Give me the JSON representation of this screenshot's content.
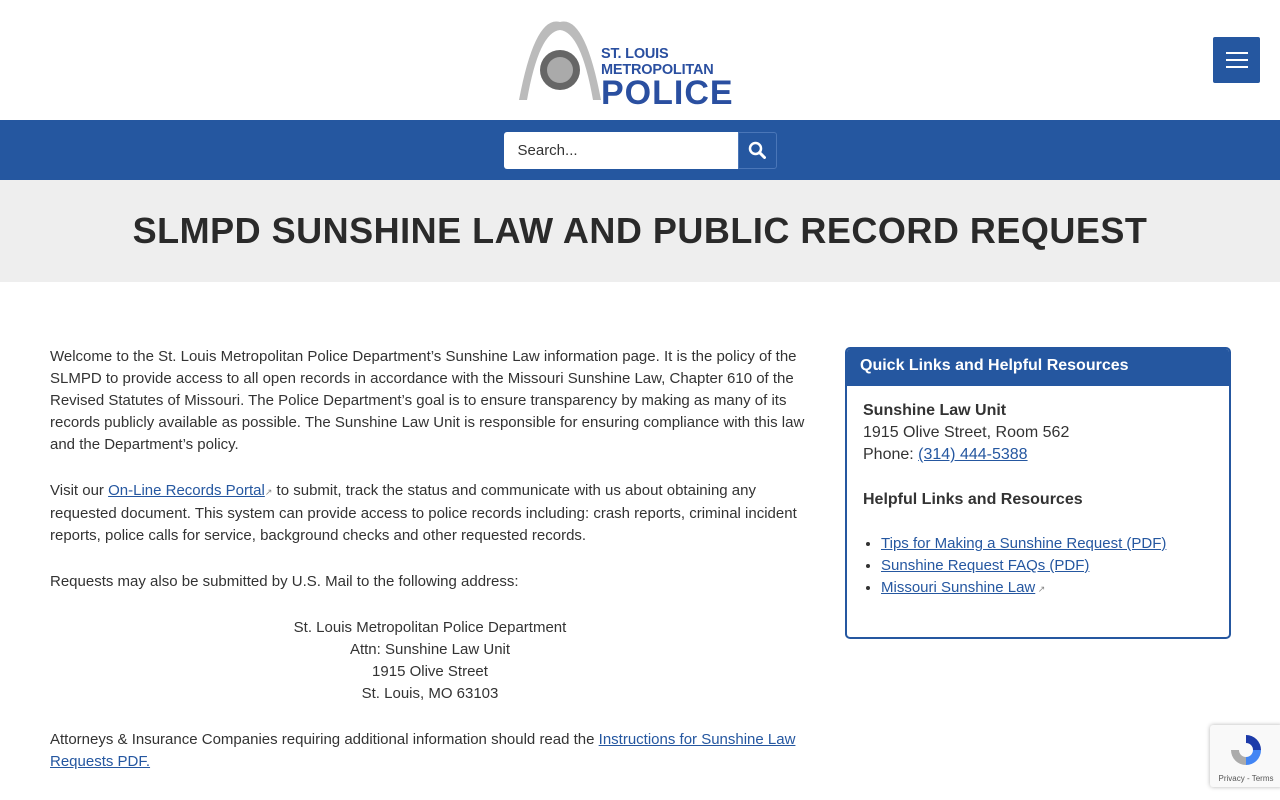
{
  "header": {
    "logo_line1": "ST. LOUIS METROPOLITAN",
    "logo_line2": "POLICE",
    "menu_icon": "hamburger-icon"
  },
  "search": {
    "placeholder": "Search...",
    "icon": "search-icon"
  },
  "page_title": "SLMPD SUNSHINE LAW AND PUBLIC RECORD REQUEST",
  "main": {
    "p1": "Welcome to the St. Louis Metropolitan Police Department’s Sunshine Law information page. It is the policy of the SLMPD to provide access to all open records in accordance with the Missouri Sunshine Law, Chapter 610 of the Revised Statutes of Missouri. The Police Department’s goal is to ensure transparency by making as many of its records publicly available as possible. The Sunshine Law Unit is responsible for ensuring compliance with this law and the Department’s policy.",
    "p2_before": "Visit our ",
    "p2_link": "On-Line Records Portal",
    "p2_after": " to submit, track the status and communicate with us about obtaining any requested document. This system can provide access to police records including: crash reports, criminal incident reports, police calls for service, background checks and other requested records.",
    "p3": "Requests may also be submitted by U.S. Mail to the following address:",
    "address": [
      "St. Louis Metropolitan Police Department",
      "Attn: Sunshine Law Unit",
      "1915 Olive Street",
      "St. Louis, MO 63103"
    ],
    "p4_before": "Attorneys & Insurance Companies requiring additional information should read the ",
    "p4_link": "Instructions for Sunshine Law Requests PDF."
  },
  "sidebar": {
    "title": "Quick Links and Helpful Resources",
    "unit_name": "Sunshine Law Unit",
    "unit_address": "1915 Olive Street, Room 562",
    "phone_label": "Phone: ",
    "phone": "(314) 444-5388",
    "links_heading": "Helpful Links and Resources",
    "links": [
      "Tips for Making a Sunshine Request (PDF)",
      "Sunshine Request FAQs (PDF)",
      "Missouri Sunshine Law"
    ]
  },
  "recaptcha": {
    "text": "Privacy - Terms"
  }
}
